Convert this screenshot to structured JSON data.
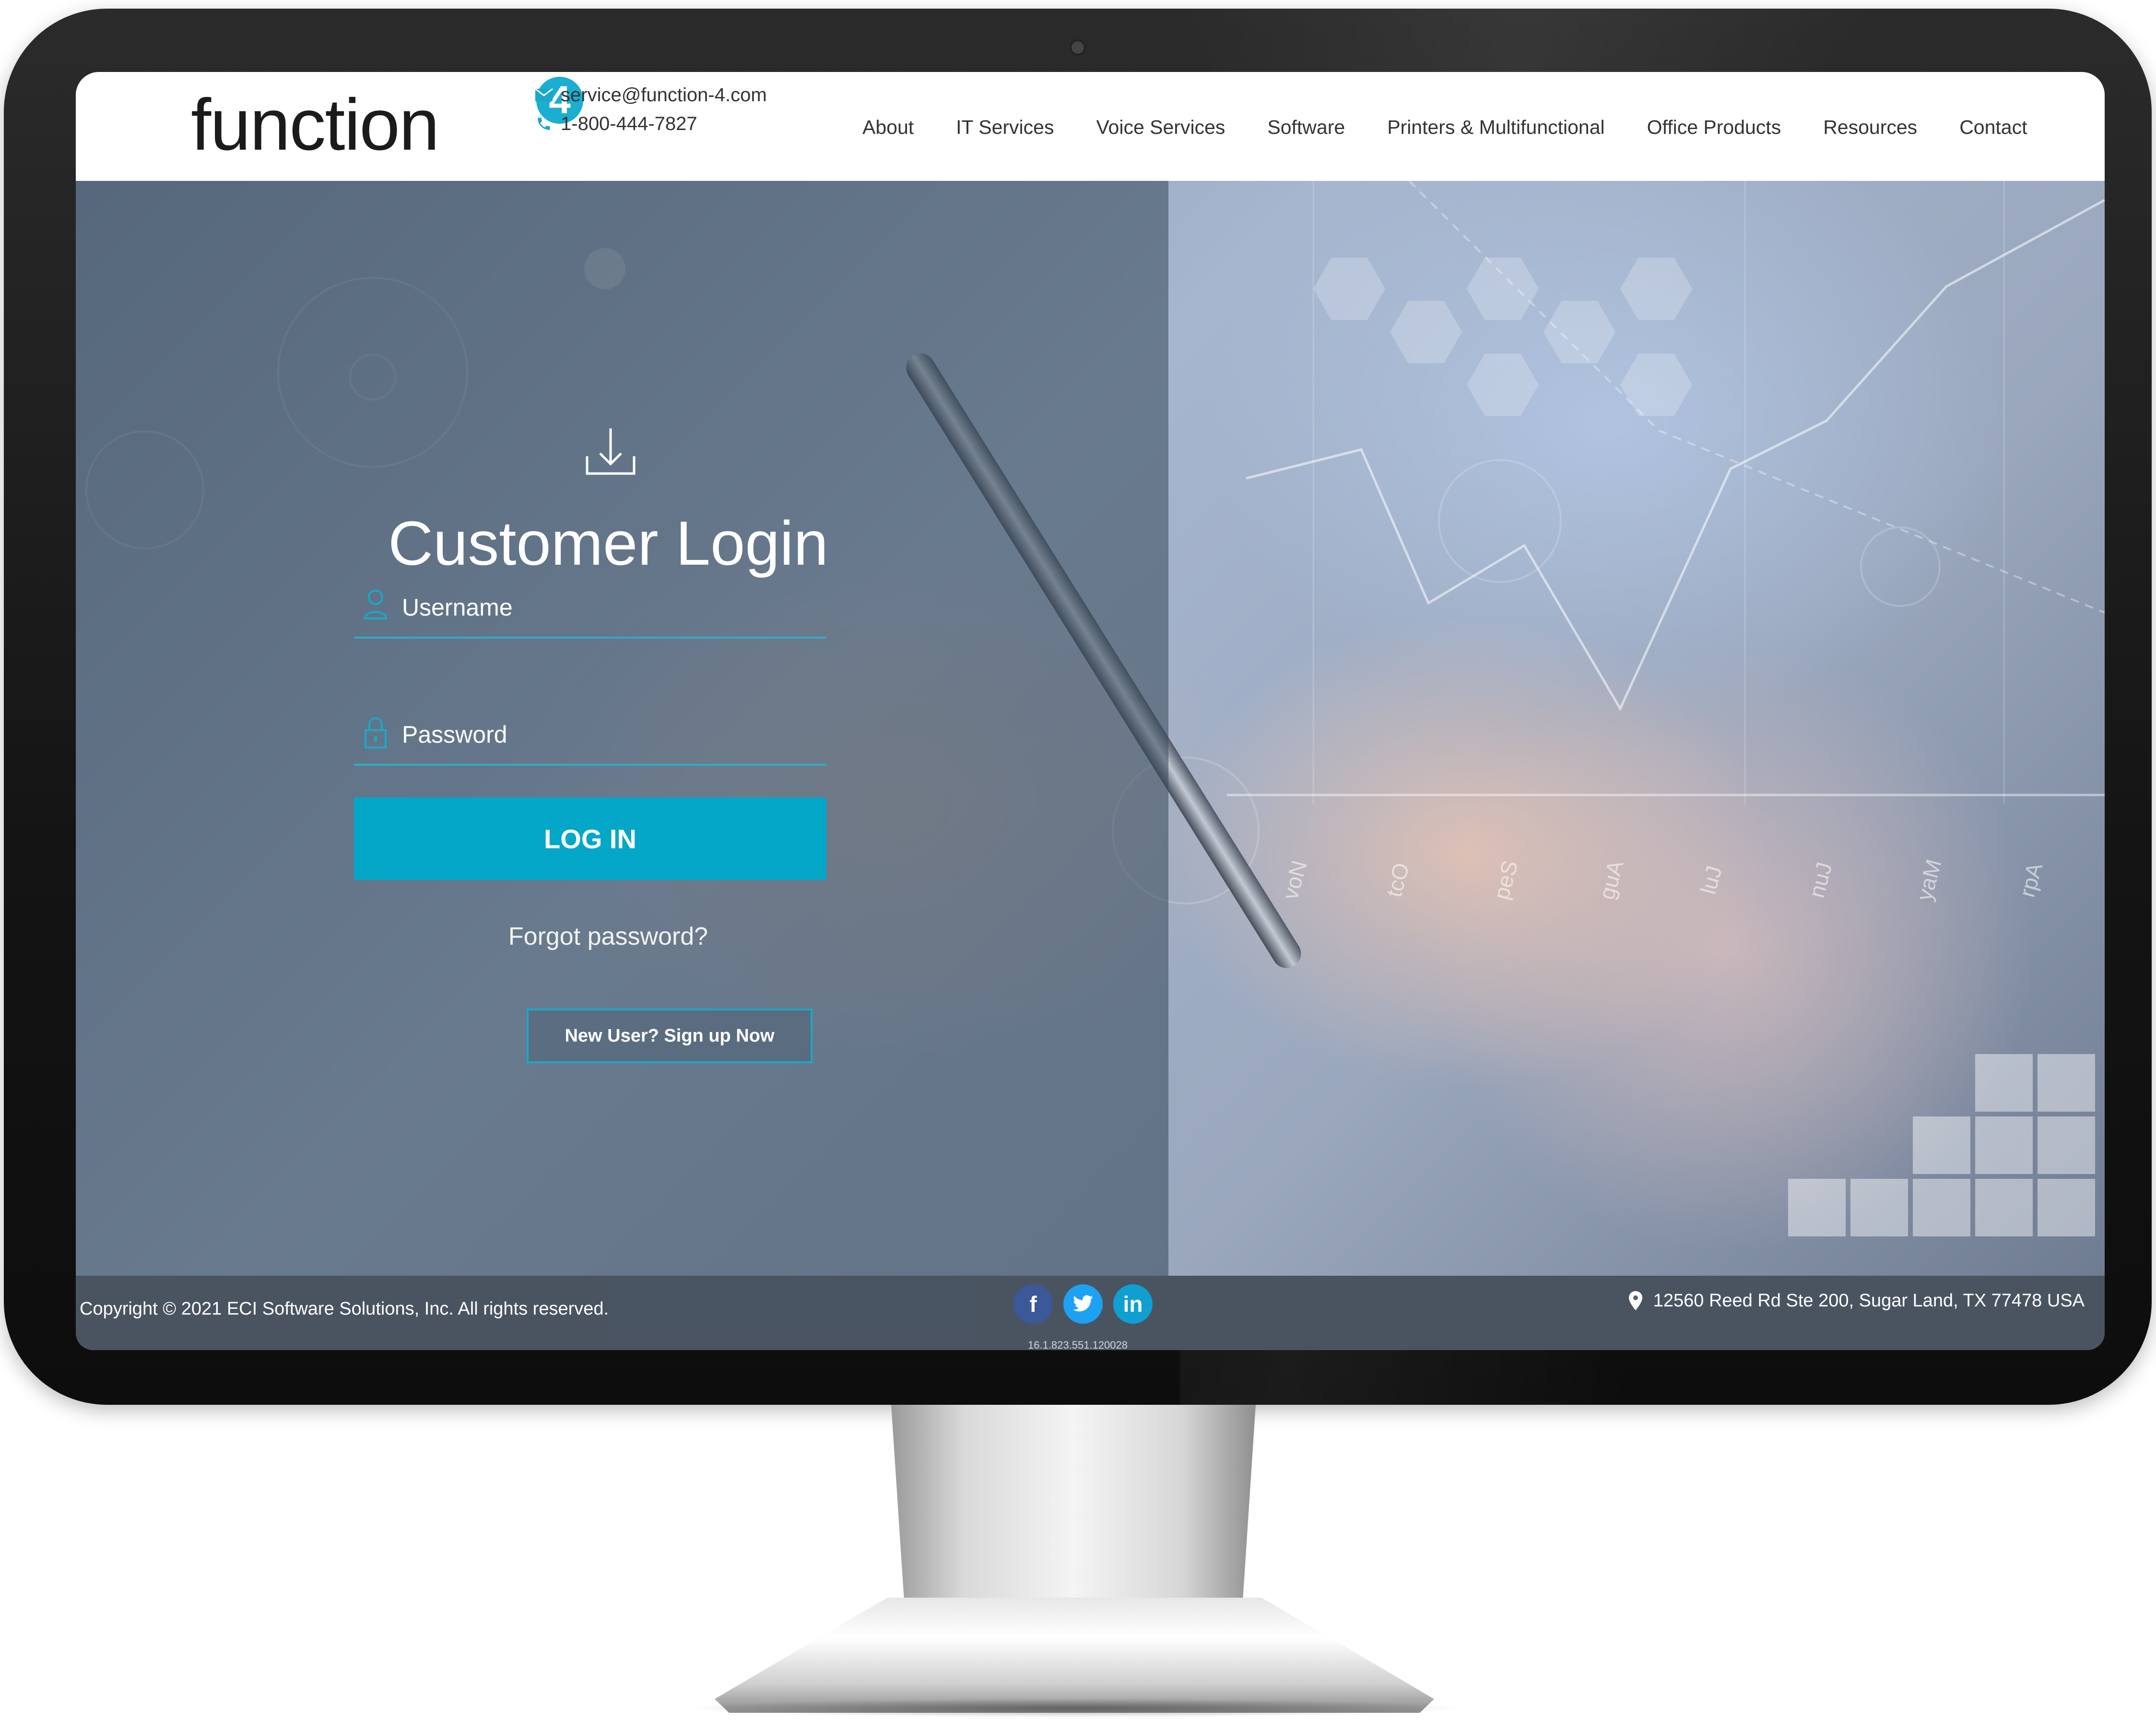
{
  "header": {
    "logo_text": "function",
    "logo_badge": "4",
    "email": "service@function-4.com",
    "phone": "1-800-444-7827",
    "nav": [
      "About",
      "IT Services",
      "Voice Services",
      "Software",
      "Printers & Multifunctional",
      "Office Products",
      "Resources",
      "Contact"
    ]
  },
  "login": {
    "title": "Customer Login",
    "username_placeholder": "Username",
    "password_placeholder": "Password",
    "login_button": "LOG IN",
    "forgot_password": "Forgot password?",
    "signup_button": "New User? Sign up Now"
  },
  "hero_chart": {
    "month_labels": [
      "voN",
      "tcO",
      "peS",
      "guA",
      "luJ",
      "nuJ",
      "yaM",
      "rpA"
    ]
  },
  "footer": {
    "copyright": "Copyright © 2021 ECI Software Solutions, Inc. All rights reserved.",
    "social": {
      "facebook": "f",
      "twitter": "t",
      "linkedin": "in"
    },
    "build_id": "16.1.823.551.120028",
    "address": "12560 Reed Rd Ste 200, Sugar Land, TX 77478 USA"
  },
  "icons": [
    "mail-icon",
    "phone-icon",
    "download-icon",
    "user-icon",
    "lock-icon",
    "map-pin-icon",
    "facebook-icon",
    "twitter-icon",
    "linkedin-icon"
  ],
  "colors": {
    "accent": "#04a7c8",
    "logo_badge": "#1aaed0",
    "facebook": "#3b5998",
    "twitter": "#1da1f2",
    "linkedin": "#0fa0d1"
  }
}
